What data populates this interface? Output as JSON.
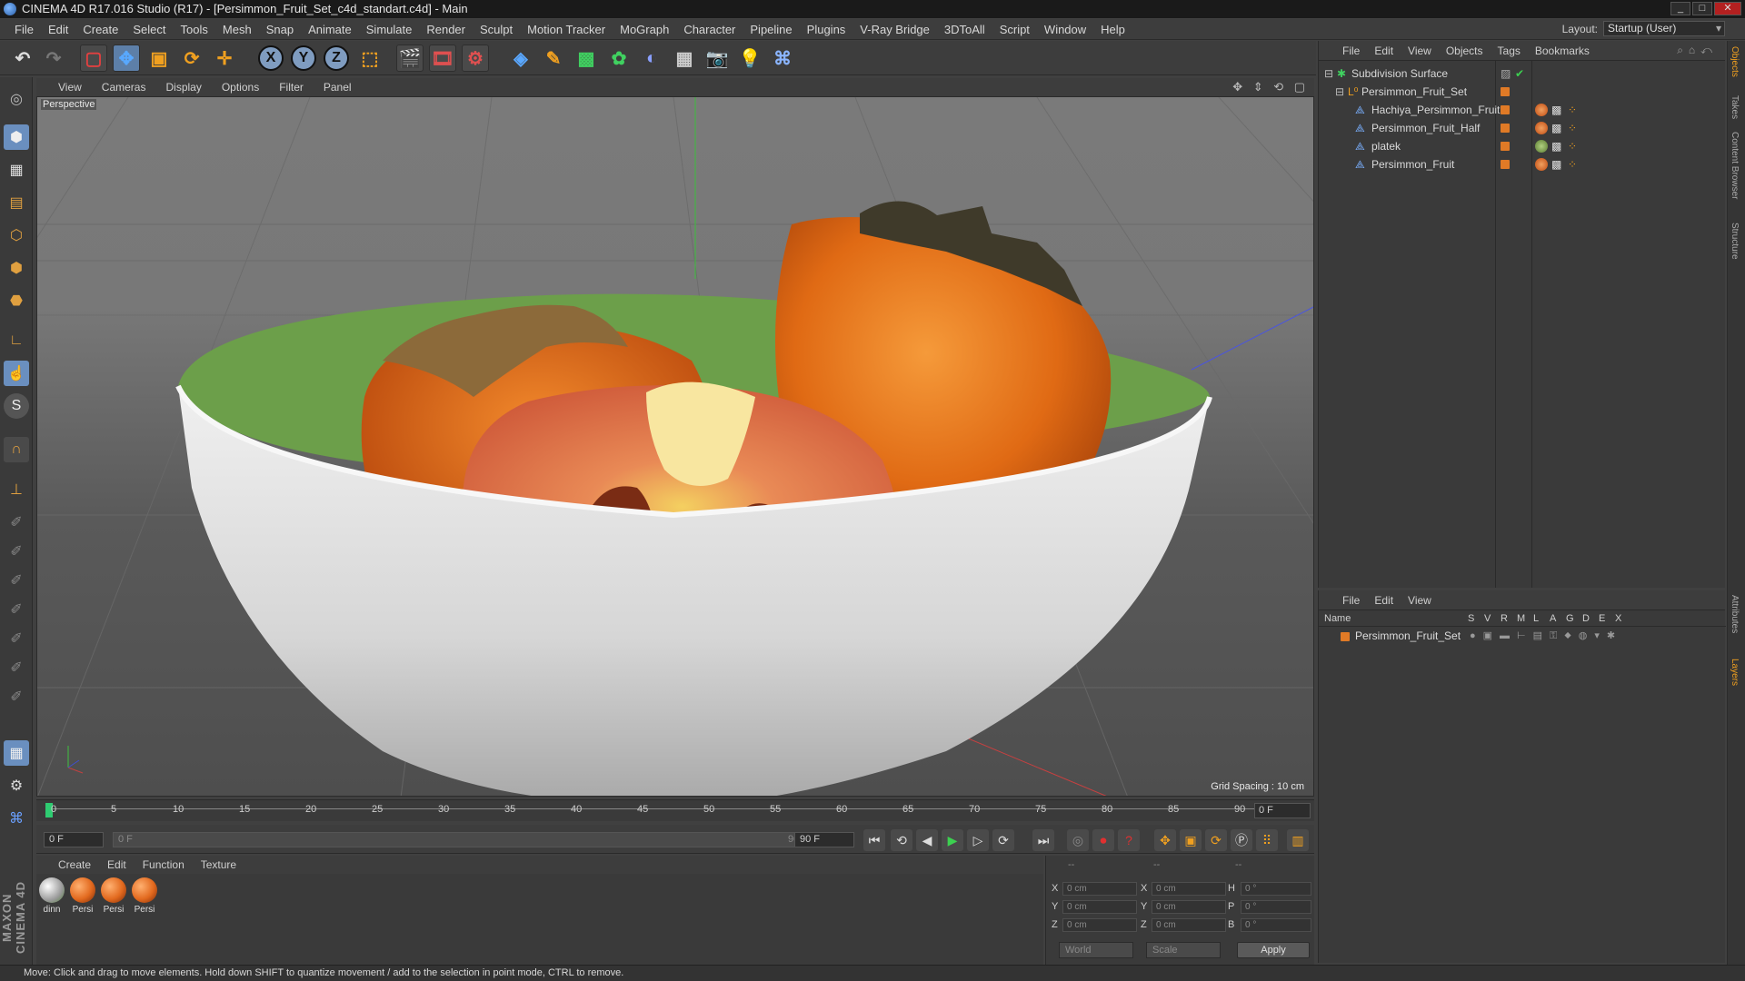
{
  "window": {
    "title": "CINEMA 4D R17.016 Studio (R17) - [Persimmon_Fruit_Set_c4d_standart.c4d] - Main",
    "buttons": [
      "_",
      "□",
      "✕"
    ]
  },
  "menubar": {
    "items": [
      "File",
      "Edit",
      "Create",
      "Select",
      "Tools",
      "Mesh",
      "Snap",
      "Animate",
      "Simulate",
      "Render",
      "Sculpt",
      "Motion Tracker",
      "MoGraph",
      "Character",
      "Pipeline",
      "Plugins",
      "V-Ray Bridge",
      "3DToAll",
      "Script",
      "Window",
      "Help"
    ],
    "layout_label": "Layout:",
    "layout_value": "Startup (User)"
  },
  "toolbar": {
    "axis_x": "X",
    "axis_y": "Y",
    "axis_z": "Z"
  },
  "viewport": {
    "menu": [
      "View",
      "Cameras",
      "Display",
      "Options",
      "Filter",
      "Panel"
    ],
    "camera_label": "Perspective",
    "grid_spacing": "Grid Spacing : 10 cm",
    "nav_icons": "✥ ⇕ ⟲ ▢"
  },
  "timeline": {
    "ticks": [
      "0",
      "5",
      "10",
      "15",
      "20",
      "25",
      "30",
      "35",
      "40",
      "45",
      "50",
      "55",
      "60",
      "65",
      "70",
      "75",
      "80",
      "85",
      "90"
    ],
    "current_frame": "0 F"
  },
  "playbar": {
    "start_frame": "0 F",
    "range_start": "0 F",
    "range_end": "90 F",
    "end_frame": "90 F"
  },
  "materials": {
    "menu": [
      "Create",
      "Edit",
      "Function",
      "Texture"
    ],
    "items": [
      {
        "label": "dinn",
        "color": "#9a9a9a"
      },
      {
        "label": "Persi",
        "color": "#e2691e"
      },
      {
        "label": "Persi",
        "color": "#e2691e"
      },
      {
        "label": "Persi",
        "color": "#e2691e"
      }
    ]
  },
  "coordinates": {
    "header": [
      "--",
      "--",
      "--"
    ],
    "rows": [
      {
        "p_label": "X",
        "p_val": "0 cm",
        "s_label": "X",
        "s_val": "0 cm",
        "r_label": "H",
        "r_val": "0 °"
      },
      {
        "p_label": "Y",
        "p_val": "0 cm",
        "s_label": "Y",
        "s_val": "0 cm",
        "r_label": "P",
        "r_val": "0 °"
      },
      {
        "p_label": "Z",
        "p_val": "0 cm",
        "s_label": "Z",
        "s_val": "0 cm",
        "r_label": "B",
        "r_val": "0 °"
      }
    ],
    "world_select": "World",
    "scale_select": "Scale",
    "apply": "Apply"
  },
  "object_manager": {
    "menu": [
      "File",
      "Edit",
      "View",
      "Objects",
      "Tags",
      "Bookmarks"
    ],
    "objects": [
      {
        "name": "Subdivision Surface"
      },
      {
        "name": "Persimmon_Fruit_Set"
      },
      {
        "name": "Hachiya_Persimmon_Fruit"
      },
      {
        "name": "Persimmon_Fruit_Half"
      },
      {
        "name": "platek"
      },
      {
        "name": "Persimmon_Fruit"
      }
    ]
  },
  "layer_manager": {
    "menu": [
      "File",
      "Edit",
      "View"
    ],
    "columns": [
      "Name",
      "S",
      "V",
      "R",
      "M",
      "L",
      "A",
      "G",
      "D",
      "E",
      "X"
    ],
    "layers": [
      {
        "name": "Persimmon_Fruit_Set",
        "color": "#e07a26"
      }
    ]
  },
  "right_tabs": [
    "Objects",
    "Takes",
    "Content Browser",
    "Structure",
    "Attributes",
    "Layers"
  ],
  "brand": "MAXON CINEMA 4D",
  "status": "Move: Click and drag to move elements. Hold down SHIFT to quantize movement / add to the selection in point mode, CTRL to remove."
}
